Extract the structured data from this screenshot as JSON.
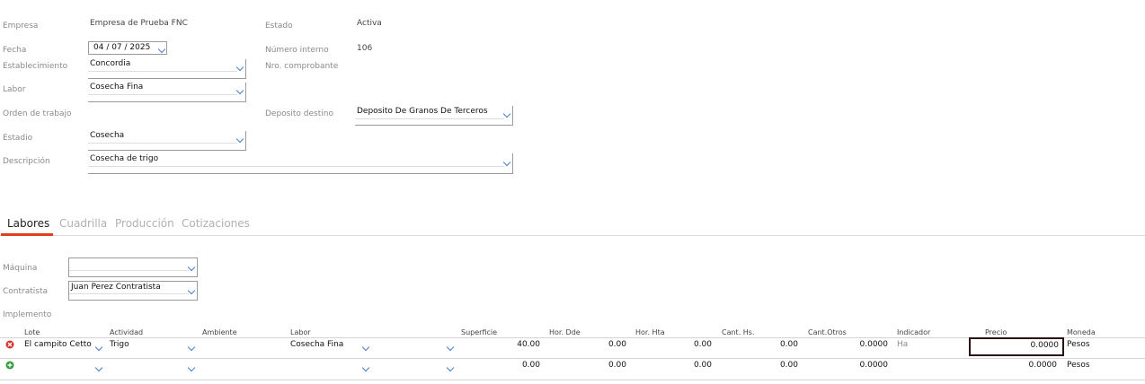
{
  "header": {
    "empresa": {
      "label": "Empresa",
      "value": "Empresa de Prueba FNC"
    },
    "estado": {
      "label": "Estado",
      "value": "Activa"
    },
    "fecha": {
      "label": "Fecha",
      "value": "04 / 07 /  2025"
    },
    "numero_interno": {
      "label": "Número interno",
      "value": "106"
    },
    "establecimiento": {
      "label": "Establecimiento",
      "value": "Concordia"
    },
    "nro_comprobante": {
      "label": "Nro. comprobante",
      "value": ""
    },
    "labor": {
      "label": "Labor",
      "value": "Cosecha Fina"
    },
    "orden_trabajo": {
      "label": "Orden de trabajo",
      "value": ""
    },
    "deposito_destino": {
      "label": "Deposito destino",
      "value": "Deposito De Granos De Terceros"
    },
    "estadio": {
      "label": "Estadio",
      "value": "Cosecha"
    },
    "descripcion": {
      "label": "Descripción",
      "value": "Cosecha de trigo"
    }
  },
  "tabs": [
    {
      "label": "Labores",
      "active": true
    },
    {
      "label": "Cuadrilla",
      "active": false
    },
    {
      "label": "Producción",
      "active": false
    },
    {
      "label": "Cotizaciones",
      "active": false
    }
  ],
  "labores": {
    "maquina": {
      "label": "Máquina",
      "value": ""
    },
    "contratista": {
      "label": "Contratista",
      "value": "Juan Perez Contratista"
    },
    "implemento": {
      "label": "Implemento"
    },
    "columns": [
      "Lote",
      "Actividad",
      "Ambiente",
      "Labor",
      "Superficie",
      "Hor. Dde",
      "Hor. Hta",
      "Cant. Hs.",
      "Cant.Otros",
      "Indicador",
      "Precio",
      "Moneda"
    ],
    "rows": [
      {
        "lote": "El campito Cetto",
        "actividad": "Trigo",
        "ambiente": "",
        "labor": "Cosecha Fina",
        "superficie": "40.00",
        "hor_dde": "0.00",
        "hor_hta": "0.00",
        "cant_hs": "0.00",
        "cant_otros": "0.0000",
        "indicador": "Ha",
        "precio": "0.0000",
        "moneda": "Pesos"
      },
      {
        "lote": "",
        "actividad": "",
        "ambiente": "",
        "labor": "",
        "superficie": "0.00",
        "hor_dde": "0.00",
        "hor_hta": "0.00",
        "cant_hs": "0.00",
        "cant_otros": "0.0000",
        "indicador": "",
        "precio": "0.0000",
        "moneda": "Pesos"
      }
    ]
  },
  "icons": {
    "remove_row": "remove-circle-icon",
    "add_row": "add-circle-icon"
  },
  "colors": {
    "tab_active_underline": "#e0401f",
    "remove": "#d9342b",
    "add": "#2e9e3a",
    "chevron": "#4a7fc4"
  }
}
